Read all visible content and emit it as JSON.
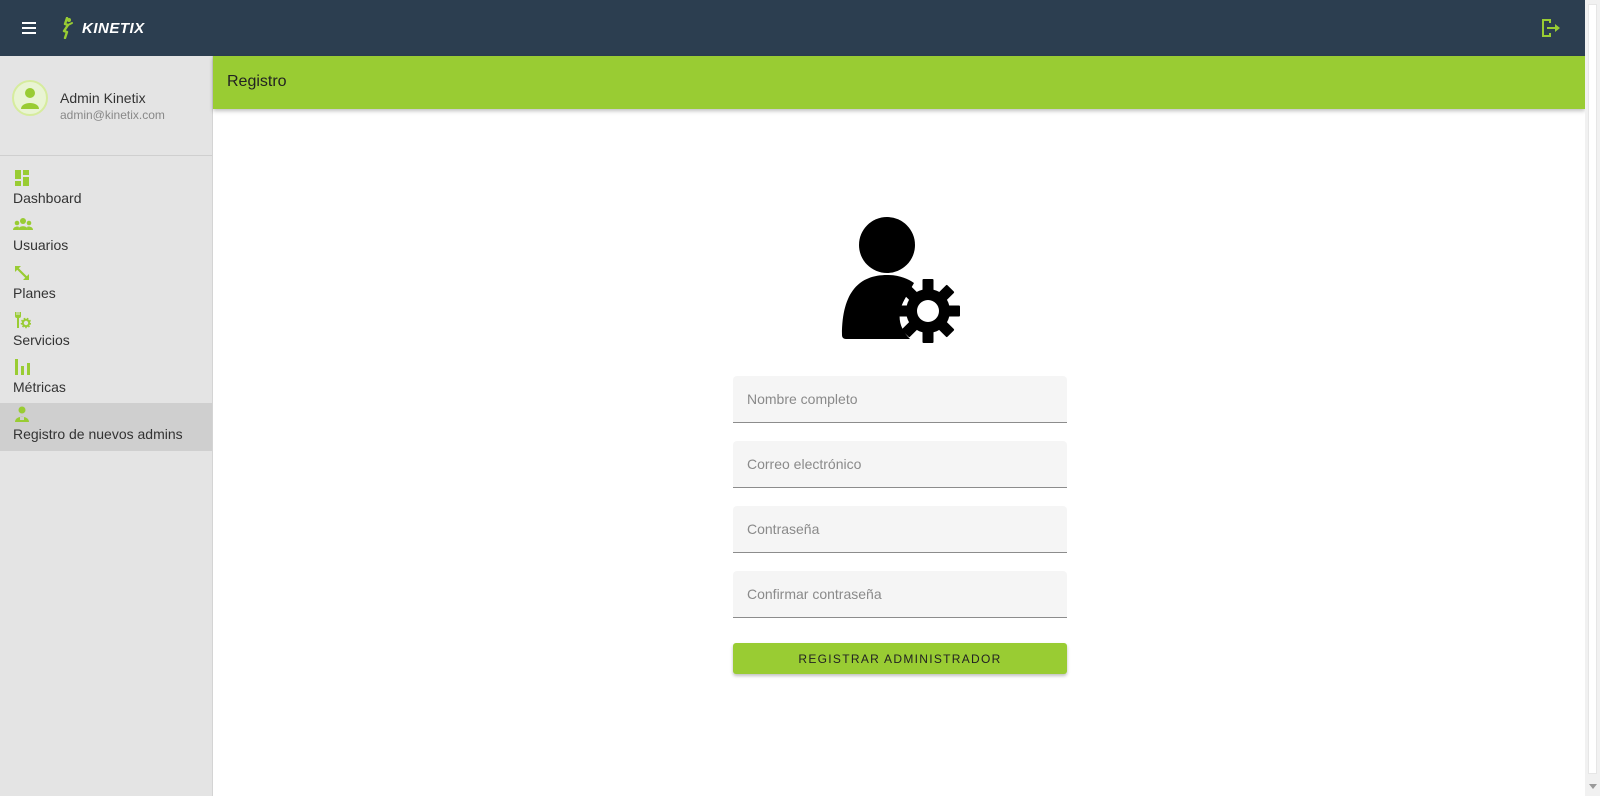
{
  "app": {
    "brand": "KINETIX",
    "accent_color": "#99cc33",
    "topbar_color": "#2c3e50",
    "menu_icon": "hamburger-menu-icon",
    "logout_icon": "logout-icon"
  },
  "profile": {
    "name": "Admin Kinetix",
    "email": "admin@kinetix.com",
    "avatar_icon": "user-avatar-icon"
  },
  "sidebar": {
    "items": [
      {
        "label": "Dashboard",
        "icon": "dashboard-icon",
        "active": false
      },
      {
        "label": "Usuarios",
        "icon": "group-icon",
        "active": false
      },
      {
        "label": "Planes",
        "icon": "expand-arrows-icon",
        "active": false
      },
      {
        "label": "Servicios",
        "icon": "wrench-gear-icon",
        "active": false
      },
      {
        "label": "Métricas",
        "icon": "bar-chart-icon",
        "active": false
      },
      {
        "label": "Registro de nuevos admins",
        "icon": "admin-user-icon",
        "active": true
      }
    ]
  },
  "page": {
    "title": "Registro",
    "hero_icon": "user-gear-icon"
  },
  "form": {
    "fields": [
      {
        "placeholder": "Nombre completo",
        "value": ""
      },
      {
        "placeholder": "Correo electrónico",
        "value": ""
      },
      {
        "placeholder": "Contraseña",
        "value": ""
      },
      {
        "placeholder": "Confirmar contraseña",
        "value": ""
      }
    ],
    "submit_label": "REGISTRAR ADMINISTRADOR"
  }
}
